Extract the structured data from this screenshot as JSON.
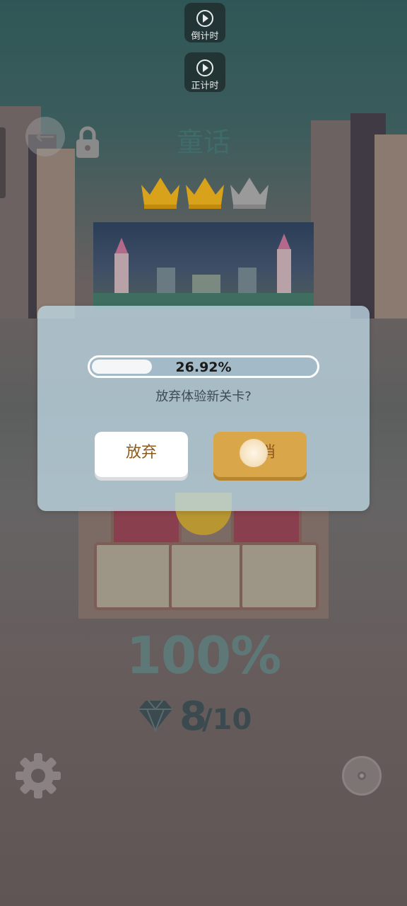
{
  "timers": {
    "countdown_label": "倒计时",
    "countup_label": "正计时"
  },
  "level": {
    "title": "童话",
    "crowns_earned": 2,
    "crowns_total": 3,
    "completion": "100%",
    "gems_collected": "8",
    "gems_total": "/10"
  },
  "dialog": {
    "progress_value": 0.2692,
    "progress_text": "26.92%",
    "question": "放弃体验新关卡?",
    "abandon_label": "放弃",
    "cancel_label": "取消"
  },
  "colors": {
    "crown_gold": "#d9a21b",
    "crown_gray": "#9a9a9a",
    "button_gold": "#d9a64a",
    "button_text": "#8d5a1e"
  },
  "icons": [
    "play-icon",
    "back-arrow-icon",
    "lock-icon",
    "crown-icon",
    "gem-icon",
    "gear-icon",
    "disc-icon"
  ]
}
